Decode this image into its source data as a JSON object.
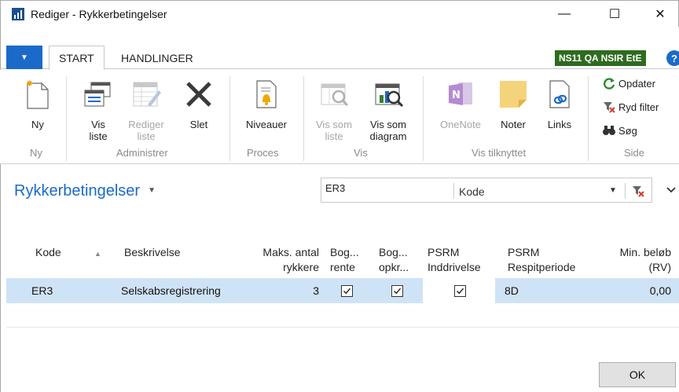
{
  "window": {
    "title": "Rediger - Rykkerbetingelser",
    "minimize": "—",
    "maximize": "☐",
    "close": "✕"
  },
  "ribbon_tabs": {
    "file_glyph": "▼",
    "tabs": [
      {
        "label": "START",
        "active": true
      },
      {
        "label": "HANDLINGER",
        "active": false
      }
    ],
    "company": "NS11 QA NSIR EtE",
    "help": "?"
  },
  "ribbon": {
    "groups": [
      {
        "label": "Ny",
        "buttons": [
          {
            "label": "Ny",
            "icon": "new-document-icon",
            "disabled": false
          }
        ]
      },
      {
        "label": "Administrer",
        "buttons": [
          {
            "label": "Vis\nliste",
            "icon": "view-list-icon",
            "disabled": false
          },
          {
            "label": "Rediger\nliste",
            "icon": "edit-list-icon",
            "disabled": true
          },
          {
            "label": "Slet",
            "icon": "delete-icon",
            "disabled": false
          }
        ]
      },
      {
        "label": "Proces",
        "buttons": [
          {
            "label": "Niveauer",
            "icon": "levels-icon",
            "disabled": false
          }
        ]
      },
      {
        "label": "Vis",
        "buttons": [
          {
            "label": "Vis som\nliste",
            "icon": "show-as-list-icon",
            "disabled": true
          },
          {
            "label": "Vis som\ndiagram",
            "icon": "show-as-chart-icon",
            "disabled": false
          }
        ]
      },
      {
        "label": "Vis tilknyttet",
        "buttons": [
          {
            "label": "OneNote",
            "icon": "onenote-icon",
            "disabled": true
          },
          {
            "label": "Noter",
            "icon": "notes-icon",
            "disabled": false
          },
          {
            "label": "Links",
            "icon": "links-icon",
            "disabled": false
          }
        ]
      },
      {
        "label": "Side",
        "buttons": [
          {
            "label": "Opdater",
            "icon": "refresh-icon"
          },
          {
            "label": "Ryd filter",
            "icon": "clear-filter-icon"
          },
          {
            "label": "Søg",
            "icon": "binoculars-icon"
          }
        ]
      }
    ]
  },
  "page": {
    "title": "Rykkerbetingelser",
    "filter_value": "ER3",
    "filter_field": "Kode"
  },
  "grid": {
    "headers": {
      "kode": "Kode",
      "beskrivelse": "Beskrivelse",
      "maks1": "Maks. antal",
      "maks2": "rykkere",
      "bogrente1": "Bog...",
      "bogrente2": "rente",
      "bogopkr1": "Bog...",
      "bogopkr2": "opkr...",
      "psrm_ind1": "PSRM",
      "psrm_ind2": "Inddrivelse",
      "psrm_resp1": "PSRM",
      "psrm_resp2": "Respitperiode",
      "minbelob1": "Min. beløb",
      "minbelob2": "(RV)"
    },
    "rows": [
      {
        "kode": "ER3",
        "beskrivelse": "Selskabsregistrering",
        "maks_antal": "3",
        "bog_rente": true,
        "bog_opkr": true,
        "psrm_inddrivelse": true,
        "psrm_respitperiode": "8D",
        "min_belob": "0,00"
      }
    ]
  },
  "footer": {
    "ok_label": "OK"
  },
  "colors": {
    "accent": "#1b6ac9",
    "selected_row": "#cfe3f7",
    "company_badge": "#2e6b1f"
  }
}
